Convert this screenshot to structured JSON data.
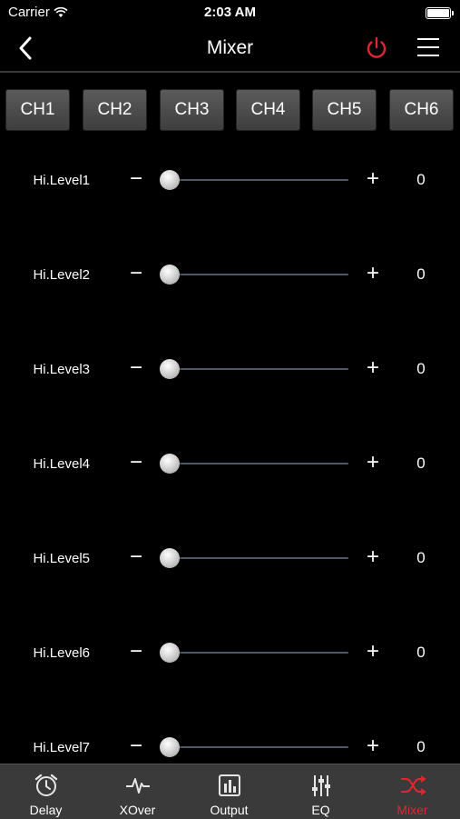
{
  "status": {
    "carrier": "Carrier",
    "time": "2:03 AM"
  },
  "nav": {
    "title": "Mixer"
  },
  "colors": {
    "accent": "#e0262e",
    "background": "#000000"
  },
  "channels": [
    {
      "label": "CH1",
      "active": true
    },
    {
      "label": "CH2",
      "active": false
    },
    {
      "label": "CH3",
      "active": false
    },
    {
      "label": "CH4",
      "active": false
    },
    {
      "label": "CH5",
      "active": false
    },
    {
      "label": "CH6",
      "active": false
    }
  ],
  "controls": {
    "minus": "−",
    "plus": "+"
  },
  "levels": [
    {
      "label": "Hi.Level1",
      "value": "0",
      "slider_fraction": 0
    },
    {
      "label": "Hi.Level2",
      "value": "0",
      "slider_fraction": 0
    },
    {
      "label": "Hi.Level3",
      "value": "0",
      "slider_fraction": 0
    },
    {
      "label": "Hi.Level4",
      "value": "0",
      "slider_fraction": 0
    },
    {
      "label": "Hi.Level5",
      "value": "0",
      "slider_fraction": 0
    },
    {
      "label": "Hi.Level6",
      "value": "0",
      "slider_fraction": 0
    },
    {
      "label": "Hi.Level7",
      "value": "0",
      "slider_fraction": 0
    }
  ],
  "tabs": [
    {
      "label": "Delay",
      "icon": "alarm-clock-icon",
      "active": false
    },
    {
      "label": "XOver",
      "icon": "waveform-icon",
      "active": false
    },
    {
      "label": "Output",
      "icon": "bar-chart-icon",
      "active": false
    },
    {
      "label": "EQ",
      "icon": "equalizer-sliders-icon",
      "active": false
    },
    {
      "label": "Mixer",
      "icon": "crossed-arrows-icon",
      "active": true
    }
  ]
}
